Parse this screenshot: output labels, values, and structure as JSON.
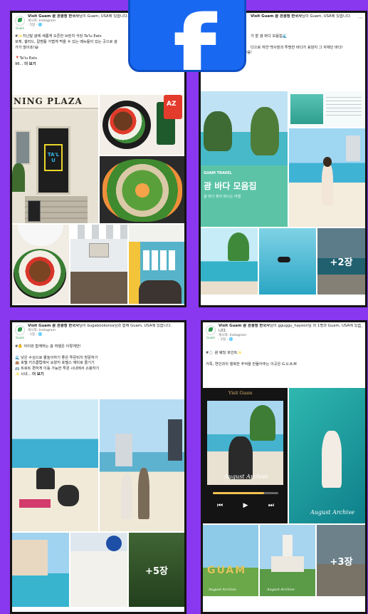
{
  "logo": {
    "icon": "facebook-f-icon",
    "color": "#1968f1"
  },
  "posts": [
    {
      "page_name": "Visit Guam 괌 관광청 한국사",
      "header_rest": "님이 Guam, USA에 있습니다.",
      "sub1": "게시자: Instagram",
      "sub2": "· 5일 · 🌐",
      "lines": [
        "#✨지난달 괌에 새롭게 오픈한 브런치 식당 Ta'lu Eats",
        "포케, 샐러드, 칼범들 가볍게 먹을 수 있는 메뉴들이 있는 곳으로 괌",
        "가가 많이죠!😄",
        "",
        "📍Ta'lu Eats",
        "96..."
      ],
      "more": "더 보기",
      "sign_top": "NING PLAZA",
      "store_sign": "TA'LU",
      "can_label": "AZ",
      "more_count": ""
    },
    {
      "page_name": "Visit Guam 괌 관광청 한국사",
      "header_rest": "님이 Guam, USA에 있습니다.",
      "lines": [
        "가 할 괌 바다 모음집🌊",
        "",
        "다으로 하얀 백사장과 투명한 바다가 표양지 그 자체인 바다!",
        "해 의 가족들이 방문하기 좋음!",
        "📍... 더 보기"
      ],
      "banner_tag": "GUAM TRAVEL",
      "banner_title": "괌 바다 모음집",
      "banner_sub": "괌 바다 찾아 떠나는 여행",
      "more_count": "+2장"
    },
    {
      "page_name": "Visit Guam 괌 관광청 한국사",
      "header_rest": "님이 bugabookorea님과 함께 Guam, USA에 있습니다.",
      "sub1": "게시자: Instagram",
      "sub2": "· 1일 · 🌐",
      "lines": [
        "#👶 아이와 함께하는 괌 여행은 이렇게만!",
        "",
        "🌊 낮은 수심으로 물놀이하기 좋은 투몬비치 방문하기",
        "🏨 호텔 키즈클럽에서 요양지 호텔스 재미로 즐기기",
        "🚌 트로트 편하게 이동 가능한 투몬 시내에서 쇼핑하기",
        "✨ 시내..."
      ],
      "more": "더 보기",
      "more_count": "+5장"
    },
    {
      "page_name": "Visit Guam 괌 관광청 한국사",
      "header_rest": "님이 gguggu_hayoon님 외 1명과 Guam, USA에 있습니다.",
      "sub1": "게시자: Instagram",
      "sub2": "· 2일 · 🌐",
      "lines": [
        "#💍 괌 웨딩 포인트✨",
        "",
        "가족, 연인과의 행복한 추억을 만들어주는 이곳은 G.U.A.M"
      ],
      "tile_label_top": "Visit Guam",
      "archive_label": "August Archive",
      "guam_letters": "GUAM",
      "more_count": "+3장"
    }
  ]
}
